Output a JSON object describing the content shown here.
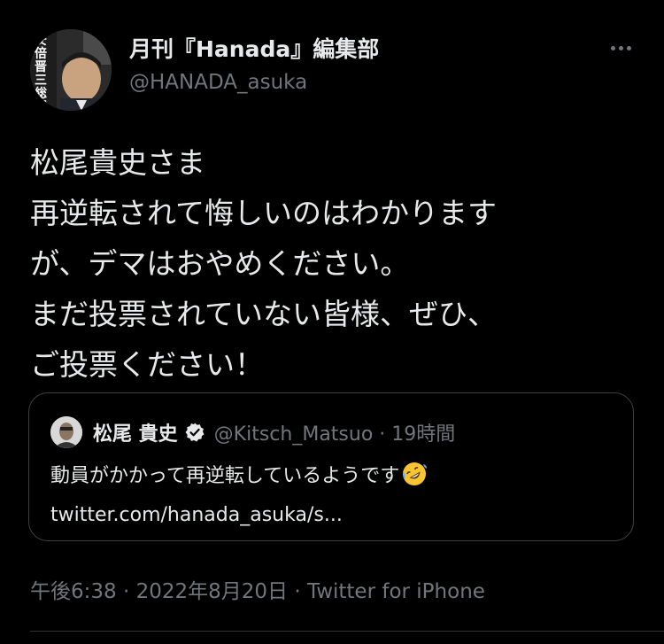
{
  "author": {
    "display_name": "月刊『Hanada』編集部",
    "handle": "@HANADA_asuka",
    "avatar_text": "安倍晋三総理大特集"
  },
  "tweet": {
    "lines": [
      "松尾貴史さま",
      "再逆転されて悔しいのはわかります",
      "が、デマはおやめください。",
      "まだ投票されていない皆様、ぜひ、",
      "ご投票ください！"
    ]
  },
  "quoted_tweet": {
    "name": "松尾 貴史",
    "verified_icon": "verified-badge-icon",
    "meta": "@Kitsch_Matsuo · 19時間",
    "text": "動員がかかって再逆転しているようです",
    "emoji": "rolling-on-floor-laughing-emoji",
    "link": "twitter.com/hanada_asuka/s..."
  },
  "timestamp": "午後6:38 · 2022年8月20日 · Twitter for iPhone",
  "colors": {
    "background": "#000000",
    "text": "#e7e9ea",
    "secondary": "#71767b",
    "border": "#3e4144"
  }
}
